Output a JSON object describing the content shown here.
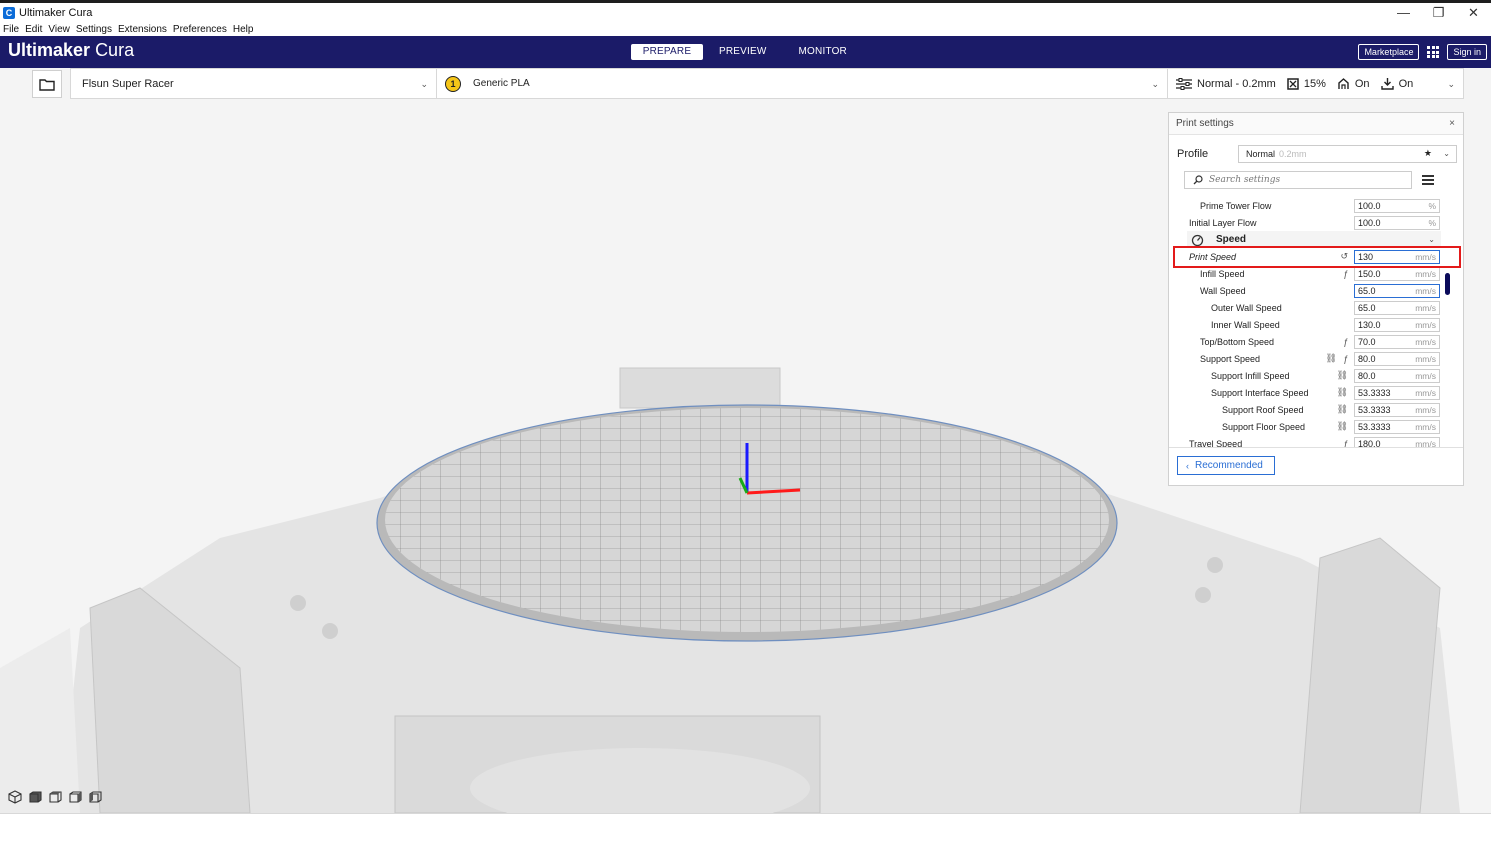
{
  "window": {
    "title": "Ultimaker Cura",
    "icon_letter": "C",
    "controls": [
      "—",
      "❐",
      "✕"
    ]
  },
  "menu": [
    "File",
    "Edit",
    "View",
    "Settings",
    "Extensions",
    "Preferences",
    "Help"
  ],
  "header": {
    "brand_bold": "Ultimaker",
    "brand_light": "Cura",
    "tabs": [
      "PREPARE",
      "PREVIEW",
      "MONITOR"
    ],
    "active_tab": "PREPARE",
    "marketplace": "Marketplace",
    "sign_in": "Sign in"
  },
  "toolbar": {
    "machine": "Flsun Super Racer",
    "extruder_number": "1",
    "material": "Generic PLA",
    "profile_summary": "Normal - 0.2mm",
    "infill": "15%",
    "support": "On",
    "adhesion": "On"
  },
  "print_settings": {
    "title": "Print settings",
    "close": "×",
    "profile_label": "Profile",
    "profile_name": "Normal",
    "profile_sub": "0.2mm",
    "search_placeholder": "Search settings",
    "recommended": "Recommended",
    "speed_section": "Speed",
    "rows": [
      {
        "label": "Prime Tower Flow",
        "value": "100.0",
        "unit": "%"
      },
      {
        "label": "Initial Layer Flow",
        "value": "100.0",
        "unit": "%"
      },
      {
        "label": "Print Speed",
        "value": "130",
        "unit": "mm/s"
      },
      {
        "label": "Infill Speed",
        "value": "150.0",
        "unit": "mm/s"
      },
      {
        "label": "Wall Speed",
        "value": "65.0",
        "unit": "mm/s"
      },
      {
        "label": "Outer Wall Speed",
        "value": "65.0",
        "unit": "mm/s"
      },
      {
        "label": "Inner Wall Speed",
        "value": "130.0",
        "unit": "mm/s"
      },
      {
        "label": "Top/Bottom Speed",
        "value": "70.0",
        "unit": "mm/s"
      },
      {
        "label": "Support Speed",
        "value": "80.0",
        "unit": "mm/s"
      },
      {
        "label": "Support Infill Speed",
        "value": "80.0",
        "unit": "mm/s"
      },
      {
        "label": "Support Interface Speed",
        "value": "53.3333",
        "unit": "mm/s"
      },
      {
        "label": "Support Roof Speed",
        "value": "53.3333",
        "unit": "mm/s"
      },
      {
        "label": "Support Floor Speed",
        "value": "53.3333",
        "unit": "mm/s"
      },
      {
        "label": "Travel Speed",
        "value": "180.0",
        "unit": "mm/s"
      }
    ]
  },
  "colors": {
    "header_bg": "#1b1b68",
    "accent_blue": "#2a6ed4",
    "highlight_red": "#e31a1a",
    "viewport_bg": "#f4f4f4"
  }
}
